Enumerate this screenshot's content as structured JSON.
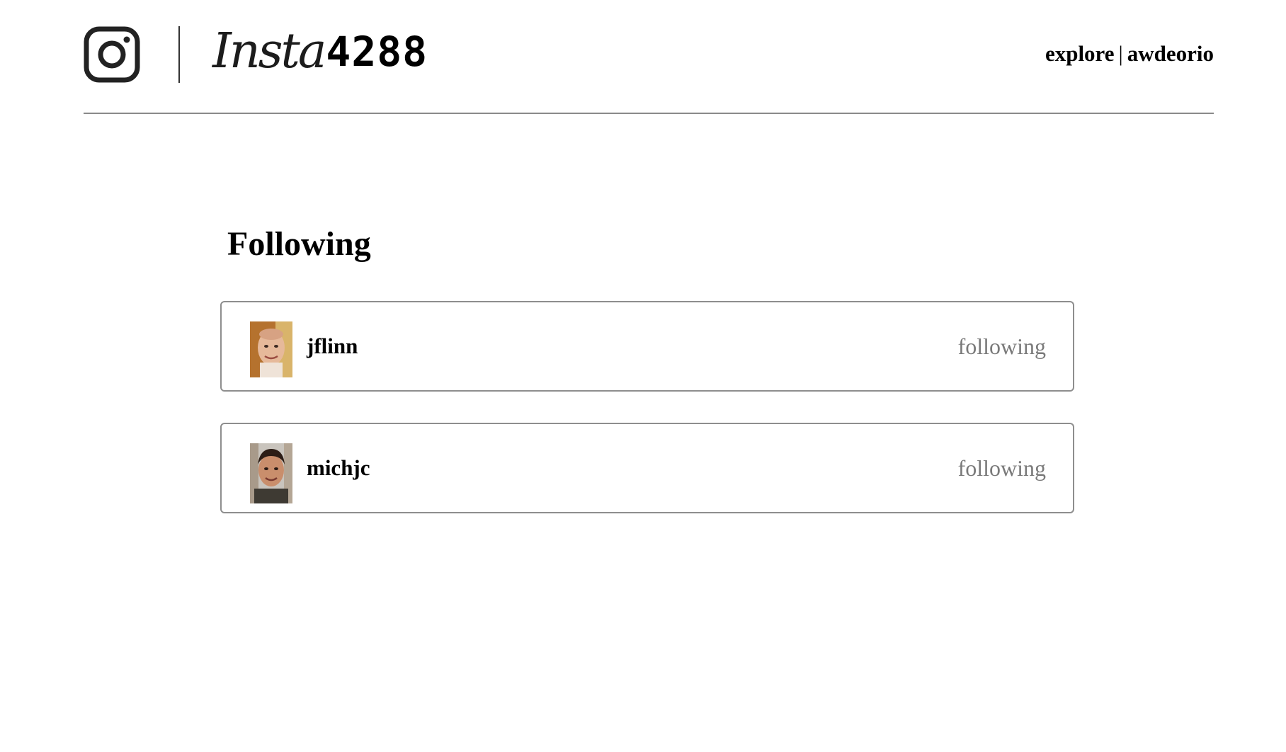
{
  "header": {
    "logo_icon": "instagram-camera-icon",
    "logo_script": "Insta",
    "logo_number": "4288",
    "nav": {
      "explore_label": "explore",
      "separator": "|",
      "user_label": "awdeorio"
    }
  },
  "main": {
    "title": "Following",
    "list": [
      {
        "username": "jflinn",
        "status": "following",
        "avatar": "avatar-jflinn"
      },
      {
        "username": "michjc",
        "status": "following",
        "avatar": "avatar-michjc"
      }
    ]
  },
  "colors": {
    "text": "#000000",
    "muted": "#7a7a7a",
    "border": "#8e8e8e",
    "divider": "#8a8a8a"
  }
}
